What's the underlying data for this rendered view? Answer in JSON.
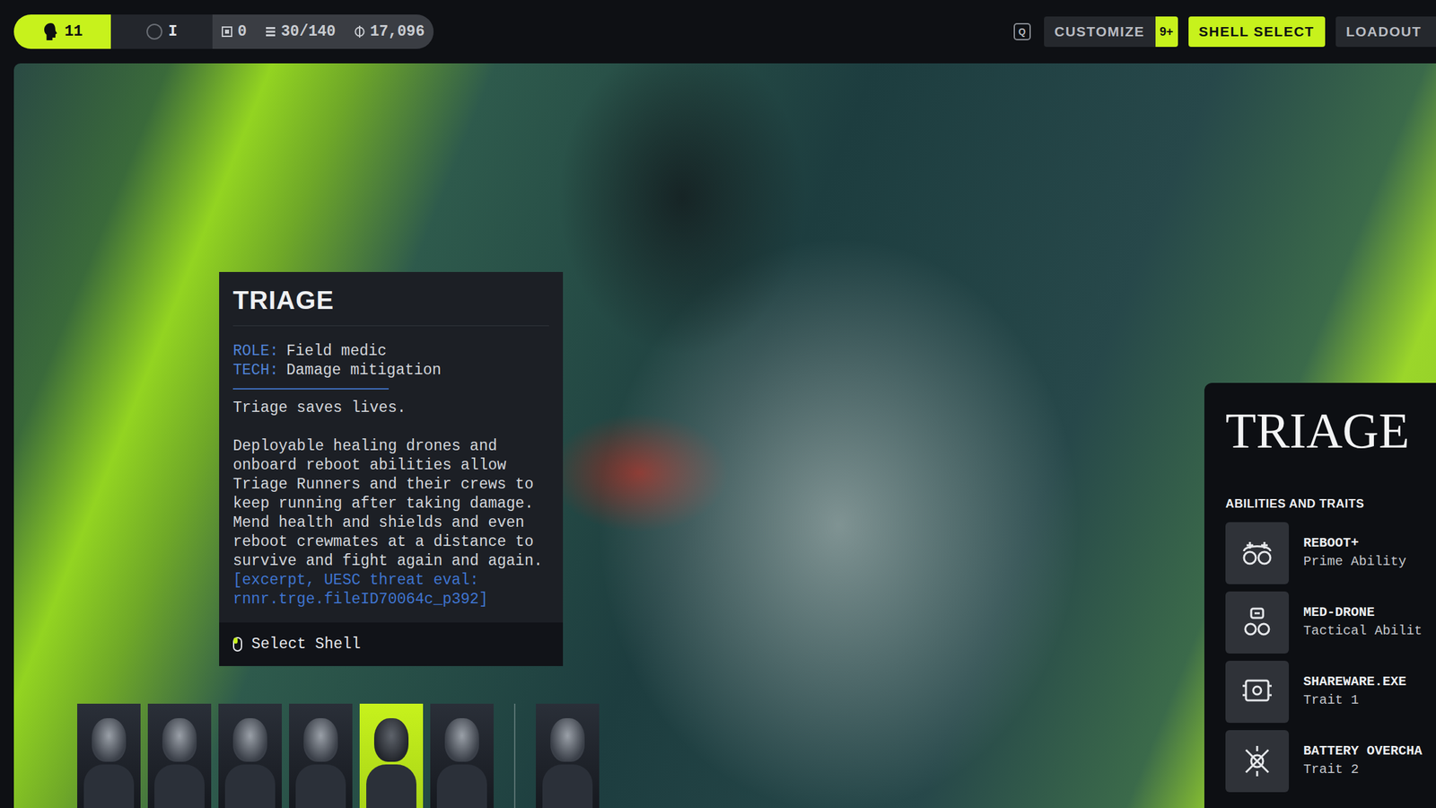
{
  "topbar": {
    "stats": [
      {
        "value": "11",
        "highlighted": true
      },
      {
        "value": "I",
        "highlighted": false
      },
      {
        "value": "0",
        "highlighted": false
      },
      {
        "value": "30/140",
        "highlighted": false
      },
      {
        "value": "17,096",
        "highlighted": false
      }
    ],
    "key_hint": "Q",
    "tabs": [
      {
        "label": "CUSTOMIZE",
        "selected": false,
        "badge": "9+"
      },
      {
        "label": "SHELL SELECT",
        "selected": true
      },
      {
        "label": "LOADOUT",
        "selected": false
      }
    ]
  },
  "shell_card": {
    "title": "TRIAGE",
    "fields": [
      {
        "label": "ROLE:",
        "value": "Field medic"
      },
      {
        "label": "TECH:",
        "value": "Damage mitigation"
      }
    ],
    "tagline": "Triage saves lives.",
    "description": "Deployable healing drones and onboard reboot abilities allow Triage Runners and their crews to keep running after taking damage. Mend health and shields and even reboot crewmates at a distance to survive and fight again and again.",
    "excerpt": "[excerpt, UESC threat eval: rnnr.trge.fileID70064c_p392]",
    "action": "Select Shell"
  },
  "shells": [
    {
      "selected": false
    },
    {
      "selected": false
    },
    {
      "selected": false
    },
    {
      "selected": false
    },
    {
      "selected": true
    },
    {
      "selected": false
    },
    {
      "selected": false
    }
  ],
  "details": {
    "title": "TRIAGE",
    "heading": "ABILITIES AND TRAITS",
    "items": [
      {
        "name": "REBOOT+",
        "type": "Prime Ability"
      },
      {
        "name": "MED-DRONE",
        "type": "Tactical Abilit"
      },
      {
        "name": "SHAREWARE.EXE",
        "type": "Trait 1"
      },
      {
        "name": "BATTERY OVERCHA",
        "type": "Trait 2"
      }
    ]
  }
}
